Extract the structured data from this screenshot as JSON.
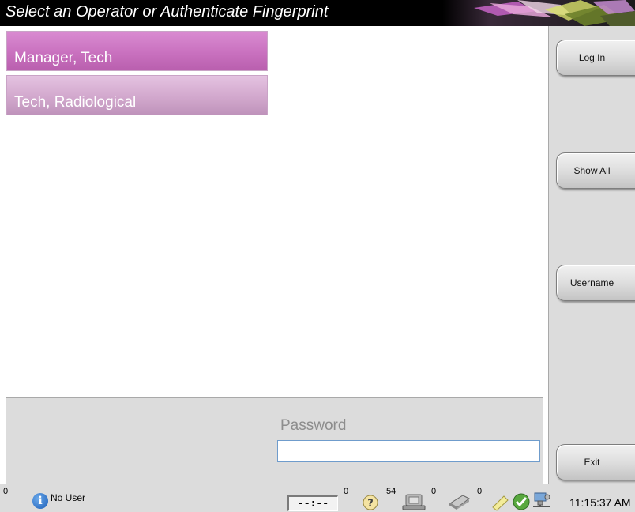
{
  "title": "Select an Operator or Authenticate Fingerprint",
  "operators": [
    {
      "label": "Manager, Tech"
    },
    {
      "label": "Tech, Radiological"
    }
  ],
  "password": {
    "label": "Password",
    "value": ""
  },
  "side_buttons": {
    "login": "Log In",
    "show_all": "Show All",
    "username": "Username",
    "exit": "Exit"
  },
  "status": {
    "info_count": "0",
    "info_icon": "i",
    "user": "No User",
    "timer": "--:--",
    "help_count": "0",
    "device_count": "54",
    "printer_count": "0",
    "archive_count": "0",
    "time": "11:15:37 AM"
  },
  "colors": {
    "operator_selected": "#c971bf",
    "operator_normal": "#d2a8cd",
    "panel_bg": "#dcdcdc"
  },
  "icons": [
    "info-icon",
    "help-icon",
    "device-icon",
    "printer-icon",
    "archive-icon",
    "check-icon",
    "network-icon"
  ]
}
